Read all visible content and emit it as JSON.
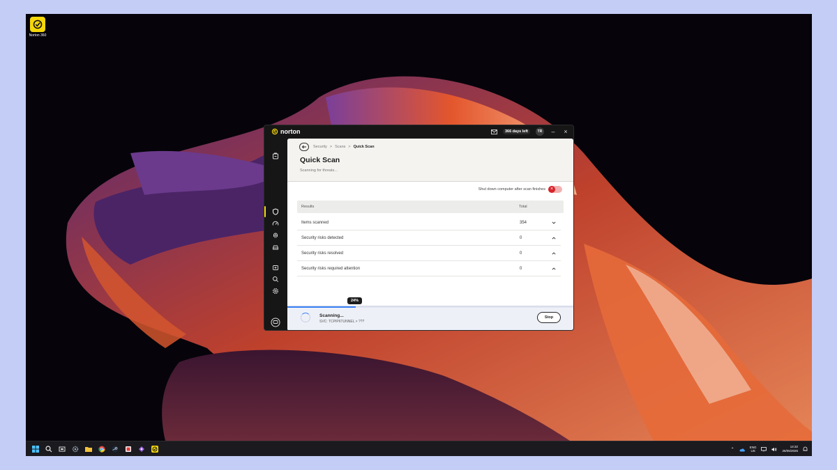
{
  "desktop": {
    "icon_label": "Norton 360"
  },
  "window": {
    "brand": "norton",
    "days_left": "366 days left",
    "avatar": "TR",
    "minimize": "–",
    "close": "×"
  },
  "nav": {
    "icons": [
      "home-icon",
      "shield-icon",
      "speedometer-icon",
      "fingerprint-icon",
      "car-icon",
      "first-aid-icon",
      "search-icon",
      "gear-icon",
      "chat-icon"
    ],
    "active": "shield-icon"
  },
  "breadcrumb": {
    "items": [
      "Security",
      "Scans",
      "Quick Scan"
    ],
    "separator": ">"
  },
  "page": {
    "title": "Quick Scan",
    "subtitle": "Scanning for threats..."
  },
  "options": {
    "shutdown_label": "Shut down computer after scan finishes",
    "shutdown_enabled": false
  },
  "results": {
    "headers": [
      "Results",
      "Total"
    ],
    "rows": [
      {
        "label": "Items scanned",
        "value": "354",
        "chevron": "down"
      },
      {
        "label": "Security risks detected",
        "value": "0",
        "chevron": "up"
      },
      {
        "label": "Security risks resolved",
        "value": "0",
        "chevron": "up"
      },
      {
        "label": "Security risks required attention",
        "value": "0",
        "chevron": "up"
      }
    ]
  },
  "scan": {
    "progress_percent": 24,
    "progress_label": "24%",
    "status": "Scanning...",
    "current_item": "SVC: TCPIP6TUNNEL > ???",
    "stop_label": "Stop"
  },
  "taskbar": {
    "lang_line1": "ENG",
    "lang_line2": "US",
    "time": "14:32",
    "date": "26/05/2026"
  },
  "colors": {
    "norton_yellow": "#f5d70a",
    "progress_blue": "#3b82f6",
    "toggle_red": "#d8232a"
  }
}
